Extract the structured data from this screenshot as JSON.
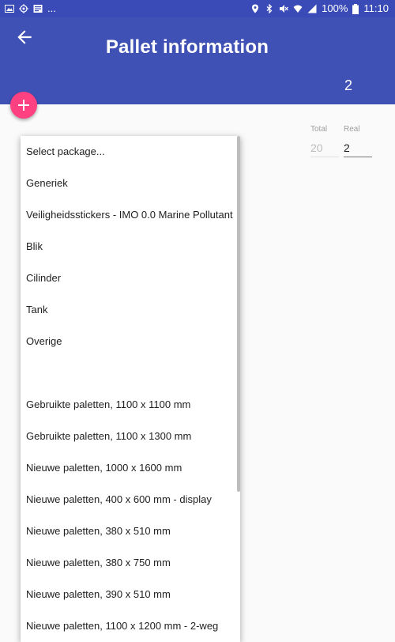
{
  "status_bar": {
    "icons_left": [
      "image-icon",
      "location-target-icon",
      "message-icon"
    ],
    "overflow": "...",
    "icons_right": [
      "location-pin-icon",
      "bluetooth-icon",
      "mute-icon",
      "wifi-icon",
      "signal-icon"
    ],
    "battery": "100%",
    "time": "11:10"
  },
  "appbar": {
    "title": "Pallet information",
    "count": "2"
  },
  "quantities": {
    "total_label": "Total",
    "total_value": "20",
    "real_label": "Real",
    "real_value": "2"
  },
  "dropdown": {
    "items": [
      "Select package...",
      "Generiek",
      "Veiligheidsstickers - IMO 0.0 Marine Pollutant",
      "Blik",
      "Cilinder",
      "Tank",
      "Overige",
      "",
      "Gebruikte paletten, 1100 x 1100 mm",
      "Gebruikte paletten, 1100 x 1300 mm",
      "Nieuwe paletten, 1000 x 1600 mm",
      "Nieuwe paletten, 400 x 600 mm - display",
      "Nieuwe paletten, 380 x 510 mm",
      "Nieuwe paletten, 380 x 750 mm",
      "Nieuwe paletten, 390 x 510 mm",
      "Nieuwe paletten, 1100 x 1200 mm - 2-weg"
    ]
  },
  "colors": {
    "primary": "#3f51b5",
    "status_bar": "#3a4bb8",
    "accent": "#ff4081"
  }
}
